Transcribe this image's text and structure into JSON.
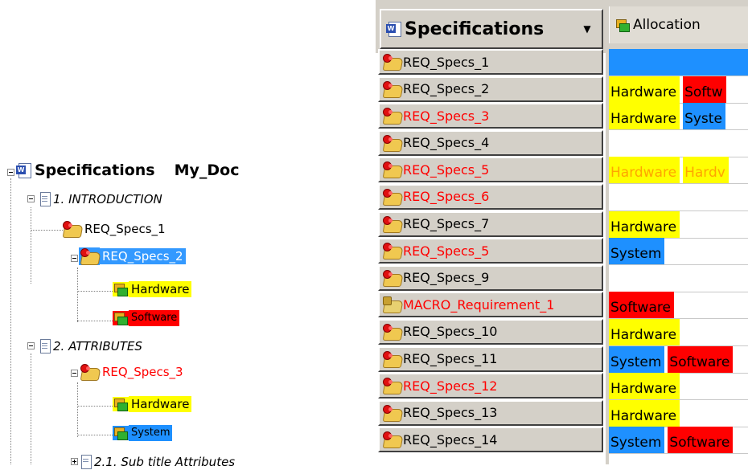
{
  "tree": {
    "root": {
      "label": "Specifications",
      "doc": "My_Doc"
    },
    "section1": {
      "label": "1. INTRODUCTION"
    },
    "req1": {
      "label": "REQ_Specs_1"
    },
    "req2": {
      "label": "REQ_Specs_2"
    },
    "req2_alloc": [
      {
        "label": "Hardware",
        "color": "#ffff00"
      },
      {
        "label": "Software",
        "color": "#ff0000"
      }
    ],
    "section2": {
      "label": "2. ATTRIBUTES"
    },
    "req3": {
      "label": "REQ_Specs_3"
    },
    "req3_alloc": [
      {
        "label": "Hardware",
        "color": "#ffff00"
      },
      {
        "label": "System",
        "color": "#1e90ff"
      }
    ],
    "section21": {
      "label": "2.1. Sub title Attributes"
    }
  },
  "grid": {
    "spec_header": "Specifications",
    "dropdown_glyph": "▼",
    "alloc_header": "Allocation",
    "rows": [
      {
        "label": "REQ_Specs_1",
        "red": false,
        "cells": [
          {
            "text": "",
            "color": "fullblue"
          }
        ]
      },
      {
        "label": "REQ_Specs_2",
        "red": false,
        "cells": [
          {
            "text": "Hardware",
            "color": "yellow"
          },
          {
            "text": "Softw",
            "color": "red"
          }
        ]
      },
      {
        "label": "REQ_Specs_3",
        "red": true,
        "cells": [
          {
            "text": "Hardware",
            "color": "yellow"
          },
          {
            "text": "Syste",
            "color": "blue"
          }
        ]
      },
      {
        "label": "REQ_Specs_4",
        "red": false,
        "cells": []
      },
      {
        "label": "REQ_Specs_5",
        "red": true,
        "cells": [
          {
            "text": "Hardware",
            "color": "ytext"
          },
          {
            "text": "Hardv",
            "color": "ytext"
          }
        ]
      },
      {
        "label": "REQ_Specs_6",
        "red": true,
        "cells": []
      },
      {
        "label": "REQ_Specs_7",
        "red": false,
        "cells": [
          {
            "text": "Hardware",
            "color": "yellow"
          }
        ]
      },
      {
        "label": "REQ_Specs_5",
        "red": true,
        "cells": [
          {
            "text": "System",
            "color": "blue"
          }
        ]
      },
      {
        "label": "REQ_Specs_9",
        "red": false,
        "cells": []
      },
      {
        "label": "MACRO_Requirement_1",
        "red": true,
        "macro": true,
        "cells": [
          {
            "text": "Software",
            "color": "red"
          }
        ]
      },
      {
        "label": "REQ_Specs_10",
        "red": false,
        "cells": [
          {
            "text": "Hardware",
            "color": "yellow"
          }
        ]
      },
      {
        "label": "REQ_Specs_11",
        "red": false,
        "cells": [
          {
            "text": "System",
            "color": "blue"
          },
          {
            "text": "Software",
            "color": "red"
          }
        ]
      },
      {
        "label": "REQ_Specs_12",
        "red": true,
        "cells": [
          {
            "text": "Hardware",
            "color": "yellow"
          }
        ]
      },
      {
        "label": "REQ_Specs_13",
        "red": false,
        "cells": [
          {
            "text": "Hardware",
            "color": "yellow"
          }
        ]
      },
      {
        "label": "REQ_Specs_14",
        "red": false,
        "cells": [
          {
            "text": "System",
            "color": "blue"
          },
          {
            "text": "Software",
            "color": "red"
          }
        ]
      }
    ]
  }
}
